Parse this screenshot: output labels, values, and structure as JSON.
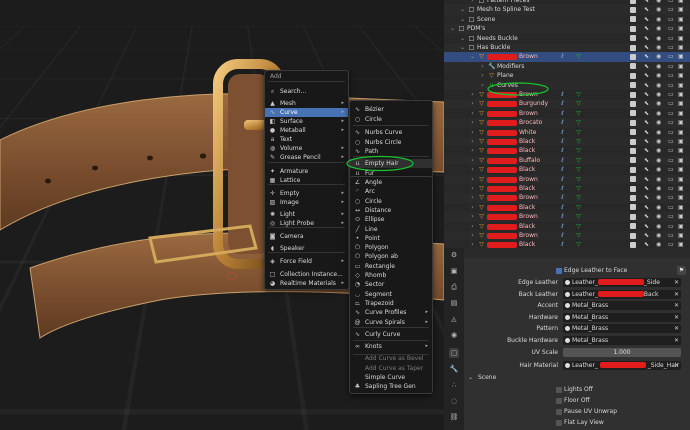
{
  "add_menu": {
    "title": "Add",
    "items": [
      {
        "label": "Search...",
        "icon": "search-icon",
        "arrow": false
      },
      {
        "label": "Mesh",
        "icon": "mesh-icon",
        "arrow": true
      },
      {
        "label": "Curve",
        "icon": "curve-icon",
        "arrow": true,
        "highlight": true
      },
      {
        "label": "Surface",
        "icon": "surface-icon",
        "arrow": true
      },
      {
        "label": "Metaball",
        "icon": "metaball-icon",
        "arrow": true
      },
      {
        "label": "Text",
        "icon": "text-icon",
        "arrow": false
      },
      {
        "label": "Volume",
        "icon": "volume-icon",
        "arrow": true
      },
      {
        "label": "Grease Pencil",
        "icon": "grease-pencil-icon",
        "arrow": true
      },
      {
        "label": "Armature",
        "icon": "armature-icon",
        "arrow": false
      },
      {
        "label": "Lattice",
        "icon": "lattice-icon",
        "arrow": false
      },
      {
        "label": "Empty",
        "icon": "empty-icon",
        "arrow": true
      },
      {
        "label": "Image",
        "icon": "image-icon",
        "arrow": true
      },
      {
        "label": "Light",
        "icon": "light-icon",
        "arrow": true
      },
      {
        "label": "Light Probe",
        "icon": "light-probe-icon",
        "arrow": true
      },
      {
        "label": "Camera",
        "icon": "camera-icon",
        "arrow": false
      },
      {
        "label": "Speaker",
        "icon": "speaker-icon",
        "arrow": false
      },
      {
        "label": "Force Field",
        "icon": "force-field-icon",
        "arrow": true
      },
      {
        "label": "Collection Instance...",
        "icon": "collection-icon",
        "arrow": false
      },
      {
        "label": "Realtime Materials",
        "icon": "material-icon",
        "arrow": true
      }
    ]
  },
  "curve_menu": {
    "items": [
      {
        "label": "Bézier",
        "icon": "bezier-icon"
      },
      {
        "label": "Circle",
        "icon": "circle-icon"
      },
      {
        "label": "Nurbs Curve",
        "icon": "nurbs-curve-icon"
      },
      {
        "label": "Nurbs Circle",
        "icon": "nurbs-circle-icon"
      },
      {
        "label": "Path",
        "icon": "path-icon"
      },
      {
        "label": "Empty Hair",
        "icon": "hair-icon",
        "highlight": true
      },
      {
        "label": "Fur",
        "icon": "fur-icon"
      }
    ]
  },
  "extra_menu": {
    "items": [
      {
        "label": "Angle",
        "icon": "angle-icon",
        "arrow": false,
        "disabled": false
      },
      {
        "label": "Arc",
        "icon": "arc-icon",
        "arrow": false,
        "disabled": false
      },
      {
        "label": "Circle",
        "icon": "circle-icon",
        "arrow": false,
        "disabled": false
      },
      {
        "label": "Distance",
        "icon": "distance-icon",
        "arrow": false,
        "disabled": false
      },
      {
        "label": "Ellipse",
        "icon": "ellipse-icon",
        "arrow": false,
        "disabled": false
      },
      {
        "label": "Line",
        "icon": "line-icon",
        "arrow": false,
        "disabled": false
      },
      {
        "label": "Point",
        "icon": "point-icon",
        "arrow": false,
        "disabled": false
      },
      {
        "label": "Polygon",
        "icon": "polygon-icon",
        "arrow": false,
        "disabled": false
      },
      {
        "label": "Polygon ab",
        "icon": "polygon-icon",
        "arrow": false,
        "disabled": false
      },
      {
        "label": "Rectangle",
        "icon": "rectangle-icon",
        "arrow": false,
        "disabled": false
      },
      {
        "label": "Rhomb",
        "icon": "rhomb-icon",
        "arrow": false,
        "disabled": false
      },
      {
        "label": "Sector",
        "icon": "sector-icon",
        "arrow": false,
        "disabled": false
      },
      {
        "label": "Segment",
        "icon": "segment-icon",
        "arrow": false,
        "disabled": false
      },
      {
        "label": "Trapezoid",
        "icon": "trapezoid-icon",
        "arrow": false,
        "disabled": false
      },
      {
        "label": "Curve Profiles",
        "icon": "curve-profiles-icon",
        "arrow": true,
        "disabled": false
      },
      {
        "label": "Curve Spirals",
        "icon": "curve-spirals-icon",
        "arrow": true,
        "disabled": false
      },
      {
        "label": "Curly Curve",
        "icon": "curly-curve-icon",
        "arrow": false,
        "disabled": false
      },
      {
        "label": "Knots",
        "icon": "knots-icon",
        "arrow": true,
        "disabled": false
      },
      {
        "label": "Add Curve as Bevel",
        "icon": "",
        "arrow": false,
        "disabled": true
      },
      {
        "label": "Add Curve as Taper",
        "icon": "",
        "arrow": false,
        "disabled": true
      },
      {
        "label": "Simple Curve",
        "icon": "",
        "arrow": false,
        "disabled": false
      },
      {
        "label": "Sapling Tree Gen",
        "icon": "tree-icon",
        "arrow": false,
        "disabled": false
      }
    ]
  },
  "outliner": {
    "rows": [
      {
        "label": "Pattern Pieces",
        "indent": 3,
        "icon": "collection-icon",
        "redacted": false
      },
      {
        "label": "Mesh to Spline Test",
        "indent": 2,
        "icon": "",
        "redacted": false
      },
      {
        "label": "Scene",
        "indent": 2,
        "icon": "",
        "redacted": false
      },
      {
        "label": "PDM's",
        "indent": 1,
        "icon": "collection-icon",
        "redacted": false
      },
      {
        "label": "Needs Buckle",
        "indent": 2,
        "icon": "collection-icon",
        "redacted": false
      },
      {
        "label": "Has Buckle",
        "indent": 2,
        "icon": "collection-icon",
        "redacted": false
      },
      {
        "label": "Brown",
        "indent": 3,
        "icon": "mesh-icon",
        "redacted": true,
        "selected": true
      },
      {
        "label": "Modifiers",
        "indent": 4,
        "icon": "wrench-icon",
        "redacted": false
      },
      {
        "label": "Plane",
        "indent": 4,
        "icon": "mesh-icon",
        "redacted": false
      },
      {
        "label": "Curves",
        "indent": 4,
        "icon": "curves-icon",
        "redacted": false
      },
      {
        "label": "Brown",
        "indent": 3,
        "icon": "mesh-icon",
        "redacted": true
      },
      {
        "label": "Burgundy",
        "indent": 3,
        "icon": "mesh-icon",
        "redacted": true
      },
      {
        "label": "Brown",
        "indent": 3,
        "icon": "mesh-icon",
        "redacted": true
      },
      {
        "label": "Brocato",
        "indent": 3,
        "icon": "mesh-icon",
        "redacted": true
      },
      {
        "label": "White",
        "indent": 3,
        "icon": "mesh-icon",
        "redacted": true
      },
      {
        "label": "Black",
        "indent": 3,
        "icon": "mesh-icon",
        "redacted": true
      },
      {
        "label": "Black",
        "indent": 3,
        "icon": "mesh-icon",
        "redacted": true
      },
      {
        "label": "Buffalo",
        "indent": 3,
        "icon": "mesh-icon",
        "redacted": true
      },
      {
        "label": "Black",
        "indent": 3,
        "icon": "mesh-icon",
        "redacted": true
      },
      {
        "label": "Brown",
        "indent": 3,
        "icon": "mesh-icon",
        "redacted": true
      },
      {
        "label": "Black",
        "indent": 3,
        "icon": "mesh-icon",
        "redacted": true
      },
      {
        "label": "Brown",
        "indent": 3,
        "icon": "mesh-icon",
        "redacted": true
      },
      {
        "label": "Black",
        "indent": 3,
        "icon": "mesh-icon",
        "redacted": true
      },
      {
        "label": "Brown",
        "indent": 3,
        "icon": "mesh-icon",
        "redacted": true
      },
      {
        "label": "Black",
        "indent": 3,
        "icon": "mesh-icon",
        "redacted": true
      },
      {
        "label": "Brown",
        "indent": 3,
        "icon": "mesh-icon",
        "redacted": true
      },
      {
        "label": "Black",
        "indent": 3,
        "icon": "mesh-icon",
        "redacted": true
      }
    ]
  },
  "properties": {
    "checkbox_top": "Edge Leather to Face",
    "fields": [
      {
        "label": "Edge Leather",
        "value": "Leather_",
        "suffix": "_Side"
      },
      {
        "label": "Back Leather",
        "value": "Leather_",
        "suffix": "Back"
      },
      {
        "label": "Accent",
        "value": "Metal_Brass",
        "suffix": ""
      },
      {
        "label": "Hardware",
        "value": "Metal_Brass",
        "suffix": ""
      },
      {
        "label": "Pattern",
        "value": "Metal_Brass",
        "suffix": ""
      },
      {
        "label": "Buckle Hardware",
        "value": "Metal_Brass",
        "suffix": ""
      }
    ],
    "uv_scale_label": "UV Scale",
    "uv_scale_value": "1.000",
    "hair_material_label": "Hair Material",
    "hair_material_value": "Leather_",
    "hair_material_suffix": "_Side_Hair",
    "scene_section": "Scene",
    "scene_options": [
      "Lights Off",
      "Floor Off",
      "Pause UV Unwrap",
      "Flat Lay View"
    ]
  },
  "colors": {
    "highlight": "#4772b3",
    "annotation": "#19c22e",
    "redaction": "#e01c1c",
    "leather": "#8a5a32",
    "brass": "#c89040"
  }
}
